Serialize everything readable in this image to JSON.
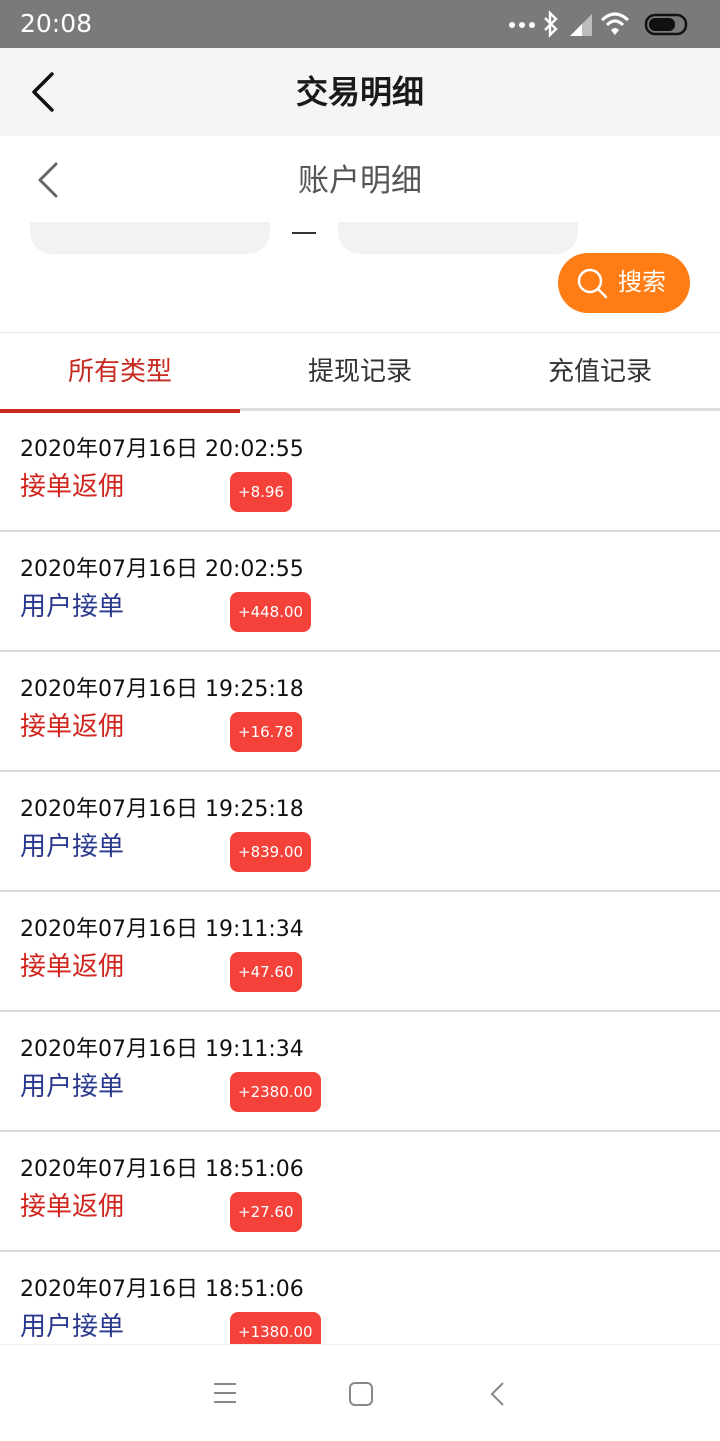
{
  "status_bar": {
    "time": "20:08",
    "icons": [
      "dots-icon",
      "bluetooth-icon",
      "signal-icon",
      "wifi-icon",
      "battery-icon"
    ]
  },
  "header": {
    "title": "交易明细"
  },
  "subheader": {
    "title": "账户明细"
  },
  "search": {
    "label": "搜索"
  },
  "tabs": [
    {
      "label": "所有类型",
      "active": true
    },
    {
      "label": "提现记录",
      "active": false
    },
    {
      "label": "充值记录",
      "active": false
    }
  ],
  "transactions": [
    {
      "time": "2020年07月16日 20:02:55",
      "type": "接单返佣",
      "amount": "+8.96"
    },
    {
      "time": "2020年07月16日 20:02:55",
      "type": "用户接单",
      "amount": "+448.00"
    },
    {
      "time": "2020年07月16日 19:25:18",
      "type": "接单返佣",
      "amount": "+16.78"
    },
    {
      "time": "2020年07月16日 19:25:18",
      "type": "用户接单",
      "amount": "+839.00"
    },
    {
      "time": "2020年07月16日 19:11:34",
      "type": "接单返佣",
      "amount": "+47.60"
    },
    {
      "time": "2020年07月16日 19:11:34",
      "type": "用户接单",
      "amount": "+2380.00"
    },
    {
      "time": "2020年07月16日 18:51:06",
      "type": "接单返佣",
      "amount": "+27.60"
    },
    {
      "time": "2020年07月16日 18:51:06",
      "type": "用户接单",
      "amount": "+1380.00"
    }
  ],
  "colors": {
    "accent_red": "#c72a20",
    "badge_red": "#f4423a",
    "search_orange": "#ff7d14",
    "type_blue": "#2b3a8f"
  }
}
